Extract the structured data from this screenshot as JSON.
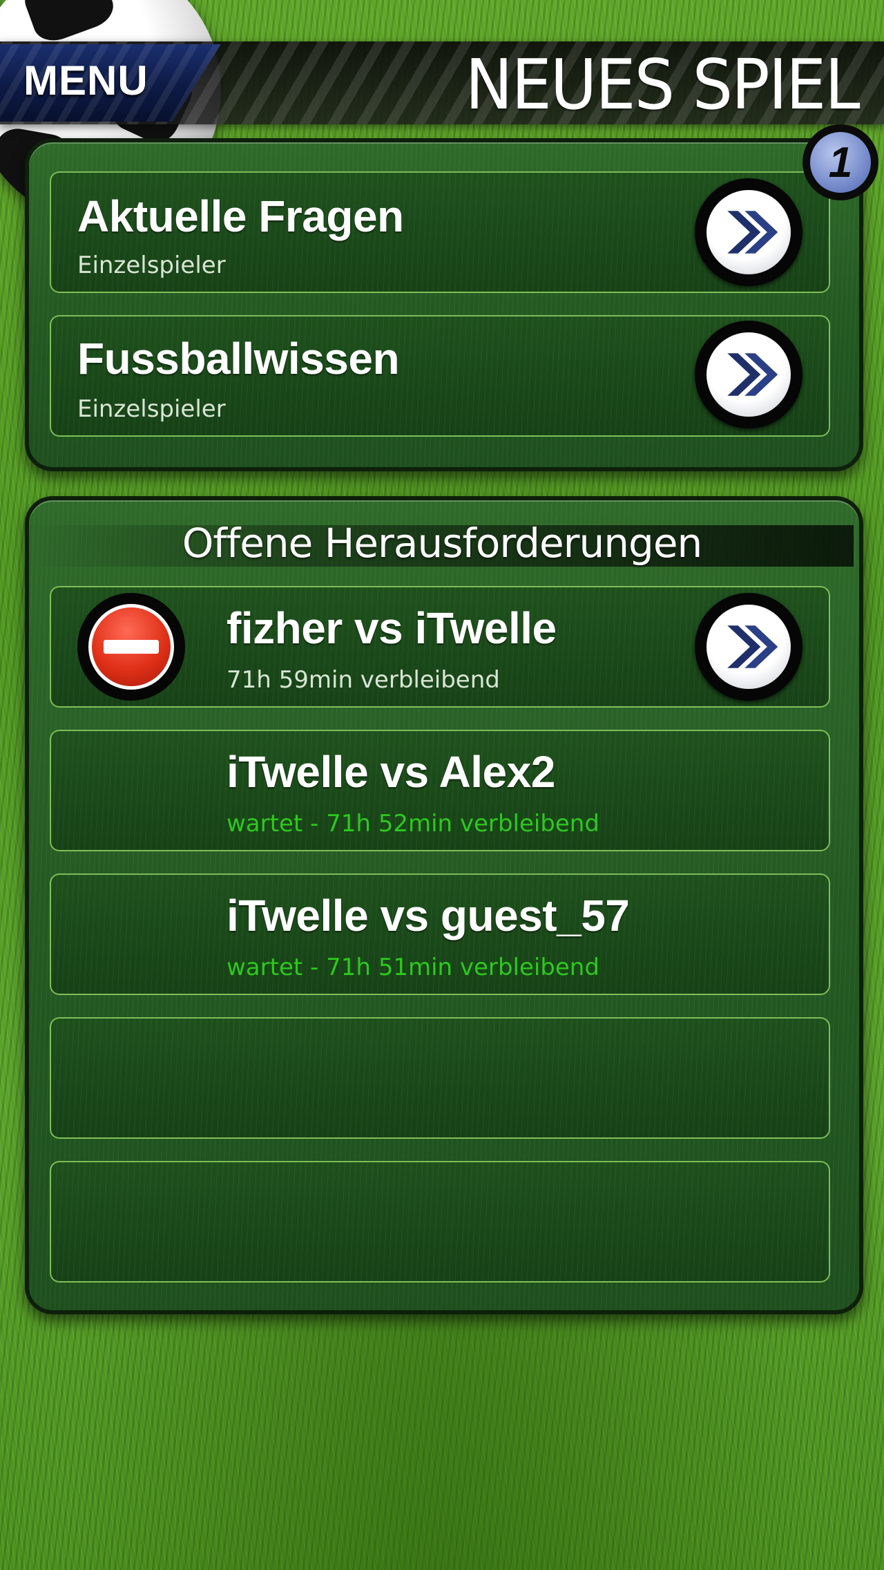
{
  "header": {
    "menu_label": "MENU",
    "title": "NEUES SPIEL",
    "badge_count": "1"
  },
  "single_player": {
    "items": [
      {
        "title": "Aktuelle Fragen",
        "subtitle": "Einzelspieler"
      },
      {
        "title": "Fussballwissen",
        "subtitle": "Einzelspieler"
      }
    ]
  },
  "challenges": {
    "section_title": "Offene Herausforderungen",
    "items": [
      {
        "title": "fizher vs iTwelle",
        "status": "71h 59min verbleibend"
      },
      {
        "title": "iTwelle vs Alex2",
        "status": "wartet - 71h 52min verbleibend"
      },
      {
        "title": "iTwelle vs guest_57",
        "status": "wartet - 71h 51min verbleibend"
      }
    ]
  },
  "colors": {
    "waiting_status": "#2ec81f",
    "badge": "#6c82c5",
    "delete": "#e03018",
    "arrow": "#2a3f86"
  },
  "icons": {
    "go": "chevron-right-circle-icon",
    "delete": "delete-minus-icon",
    "ball": "soccer-ball-icon"
  }
}
